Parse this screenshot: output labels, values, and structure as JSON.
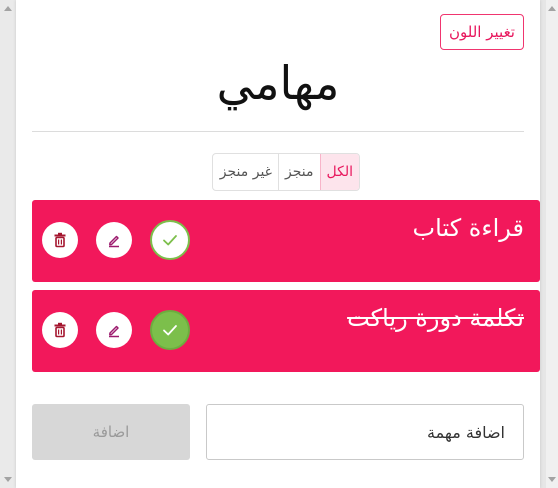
{
  "header": {
    "change_color_label": "تغيير اللون",
    "title": "مهامي"
  },
  "filters": [
    {
      "label": "الكل",
      "active": true
    },
    {
      "label": "منجز",
      "active": false
    },
    {
      "label": "غير منجز",
      "active": false
    }
  ],
  "tasks": [
    {
      "text": "قراءة كتاب",
      "done": false
    },
    {
      "text": "تكلمة دورة رياكت",
      "done": true
    }
  ],
  "form": {
    "input_placeholder": "اضافة مهمة",
    "add_label": "اضافة"
  },
  "colors": {
    "accent": "#f2185b",
    "check": "#7cbf4b",
    "disabled": "#d7d7d7"
  }
}
